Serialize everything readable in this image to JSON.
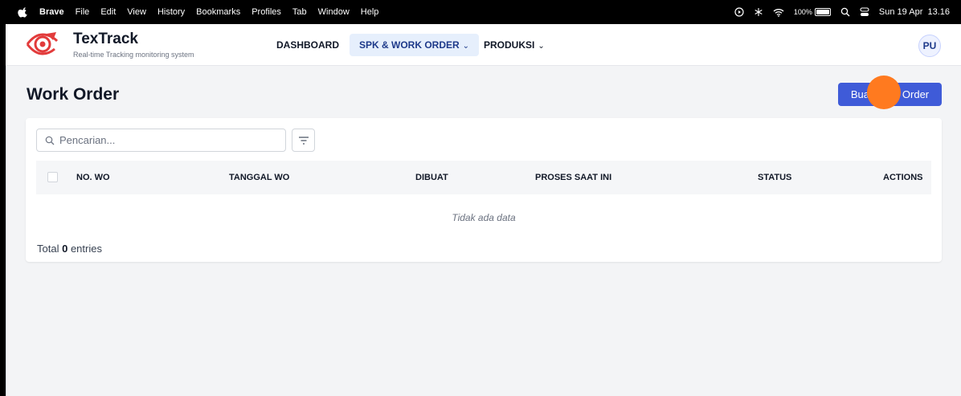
{
  "menubar": {
    "app": "Brave",
    "menus": [
      "File",
      "Edit",
      "View",
      "History",
      "Bookmarks",
      "Profiles",
      "Tab",
      "Window",
      "Help"
    ],
    "battery_percent": "100%",
    "clock": "Sun 19 Apr  13.16"
  },
  "brand": {
    "name": "TexTrack",
    "tagline": "Real-time Tracking monitoring system",
    "color": "#e23b3b"
  },
  "nav": {
    "dashboard": "DASHBOARD",
    "spk_work_order": "SPK & WORK ORDER",
    "produksi": "PRODUKSI",
    "active": "SPK & WORK ORDER"
  },
  "user": {
    "initials": "PU"
  },
  "page": {
    "title": "Work Order",
    "create_button": "Buat Work Order",
    "accent": "#3f5bd8"
  },
  "search": {
    "placeholder": "Pencarian..."
  },
  "table": {
    "columns": [
      "NO. WO",
      "TANGGAL WO",
      "DIBUAT",
      "PROSES SAAT INI",
      "STATUS",
      "ACTIONS"
    ],
    "rows": [],
    "empty_text": "Tidak ada data"
  },
  "footer": {
    "total_prefix": "Total",
    "total_count": "0",
    "total_suffix": "entries"
  }
}
